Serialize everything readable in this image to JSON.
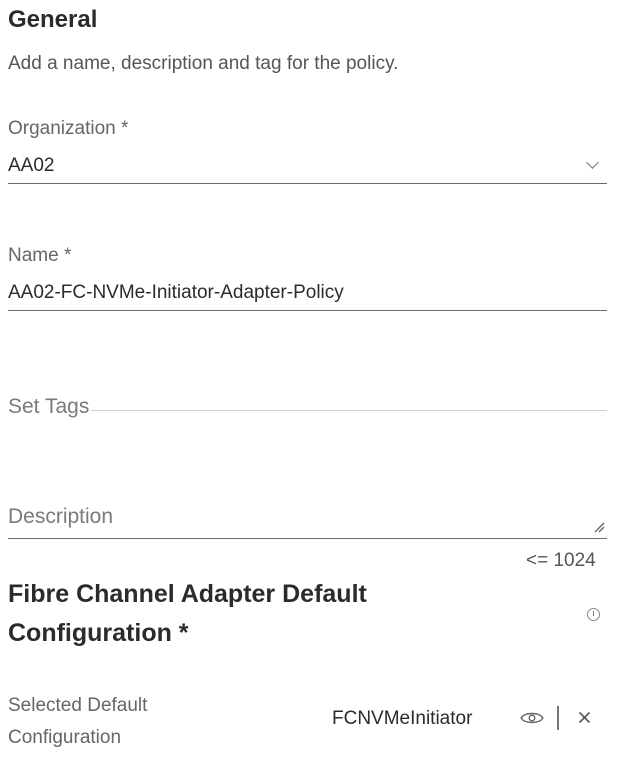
{
  "general": {
    "title": "General",
    "subtitle": "Add a name, description and tag for the policy."
  },
  "organization": {
    "label": "Organization *",
    "value": "AA02"
  },
  "name": {
    "label": "Name *",
    "value": "AA02-FC-NVMe-Initiator-Adapter-Policy"
  },
  "tags": {
    "placeholder": "Set Tags"
  },
  "description": {
    "placeholder": "Description",
    "limit": "<= 1024"
  },
  "adapter_config": {
    "title": "Fibre Channel Adapter Default Configuration *",
    "selected_label": "Selected Default Configuration",
    "selected_value": "FCNVMeInitiator"
  },
  "icons": {
    "organization_dropdown": "chevron-down-icon",
    "description_resize": "resize-handle-icon",
    "config_info": "info-icon",
    "view_config": "eye-icon",
    "remove_config": "close-icon"
  }
}
